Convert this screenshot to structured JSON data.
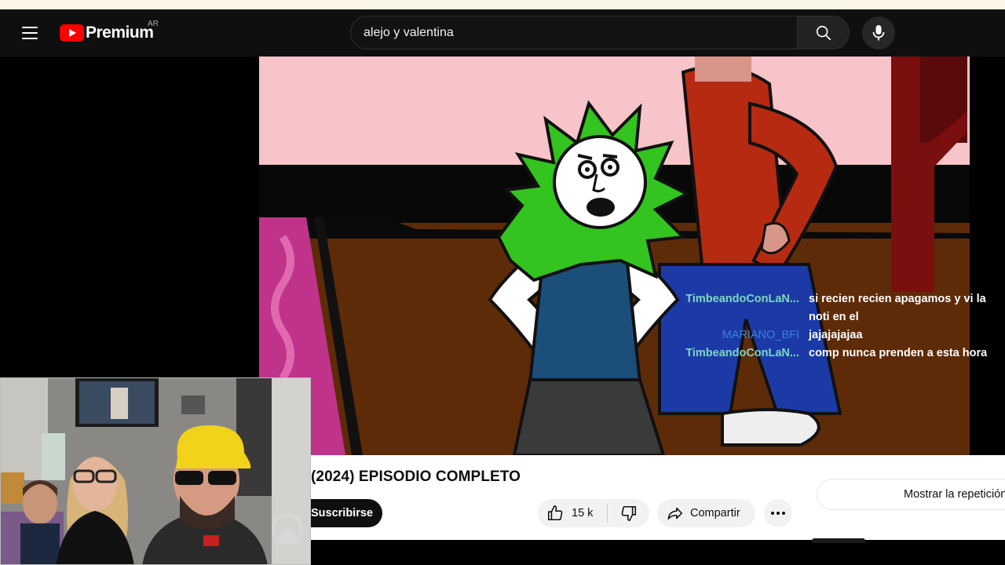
{
  "masthead": {
    "logo_text": "Premium",
    "country": "AR",
    "search_value": "alejo y valentina"
  },
  "chat": [
    {
      "user": "TimbeandoConLaN...",
      "user_color": "#7fd6c4",
      "message": "si recien recien apagamos y vi la noti en el"
    },
    {
      "user": "MARIANO_BFI",
      "user_color": "#3c7fd8",
      "message": "jajajajajaa"
    },
    {
      "user": "TimbeandoConLaN...",
      "user_color": "#7fd6c4",
      "message": "comp nunca prenden a esta hora"
    }
  ],
  "video": {
    "title": "(2024) EPISODIO COMPLETO",
    "subscribe_label": "Suscribirse",
    "like_count": "15 k",
    "share_label": "Compartir",
    "replay_label": "Mostrar la repetición"
  },
  "colors": {
    "brand_red": "#ff0000",
    "masthead_bg": "#0f0f0f",
    "hair_green": "#33c41f",
    "tank_blue": "#1c4e7a"
  }
}
